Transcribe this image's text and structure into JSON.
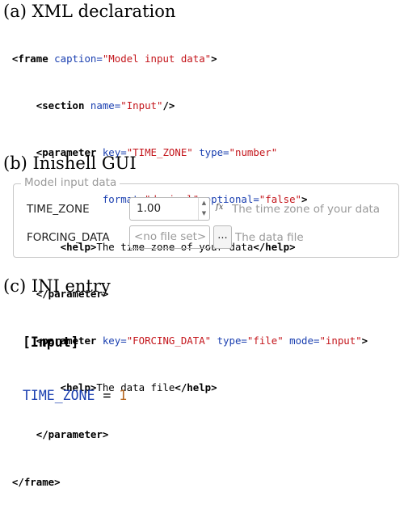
{
  "headings": {
    "xml": "(a) XML declaration",
    "gui": "(b) Inishell GUI",
    "ini": "(c) INI entry"
  },
  "xml": {
    "frame_open": "<frame",
    "frame_caption_attr": "caption=",
    "frame_caption_val": "\"Model input data\"",
    "frame_close_bracket": ">",
    "section_open": "<section",
    "section_name_attr": "name=",
    "section_name_val": "\"Input\"",
    "section_end": "/>",
    "param_open": "<parameter",
    "key_attr": "key=",
    "p1_key_val": "\"TIME_ZONE\"",
    "type_attr": "type=",
    "p1_type_val": "\"number\"",
    "format_attr": "format=",
    "p1_format_val": "\"decimal\"",
    "optional_attr": "optional=",
    "p1_optional_val": "\"false\"",
    "gt": ">",
    "help_open": "<help>",
    "help_close": "</help>",
    "p1_help_text": "The time zone of your data",
    "param_close": "</parameter>",
    "p2_key_val": "\"FORCING_DATA\"",
    "p2_type_val": "\"file\"",
    "mode_attr": "mode=",
    "p2_mode_val": "\"input\"",
    "p2_help_text": "The data file",
    "frame_end": "</frame>"
  },
  "gui": {
    "group_title": "Model input data",
    "time_zone_label": "TIME_ZONE",
    "time_zone_value": "1.00",
    "time_zone_help": "The time zone of your data",
    "fx_label": "fx",
    "forcing_label": "FORCING_DATA",
    "forcing_placeholder": "<no file set>",
    "browse_label": "...",
    "forcing_help": "The data file"
  },
  "ini": {
    "section": "[Input]",
    "key": "TIME_ZONE",
    "eq": "=",
    "value": "1"
  }
}
